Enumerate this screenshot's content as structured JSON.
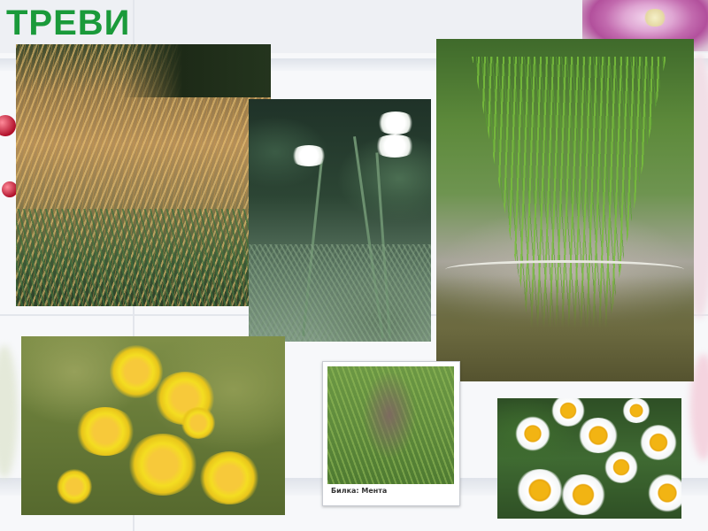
{
  "slide": {
    "title": "ТРЕВИ",
    "accent_color": "#1a9a3a"
  },
  "photos": [
    {
      "id": "feather-grass",
      "subject": "ornamental feather grass"
    },
    {
      "id": "yarrow",
      "subject": "white yarrow flowers"
    },
    {
      "id": "rush",
      "subject": "rush grass in pot"
    },
    {
      "id": "st-johns-wort",
      "subject": "yellow St John's wort flowers"
    },
    {
      "id": "mint",
      "subject": "mint plant",
      "caption": "Билка: Мента"
    },
    {
      "id": "chamomile",
      "subject": "chamomile flowers"
    },
    {
      "id": "clematis",
      "subject": "pink clematis flower"
    }
  ]
}
